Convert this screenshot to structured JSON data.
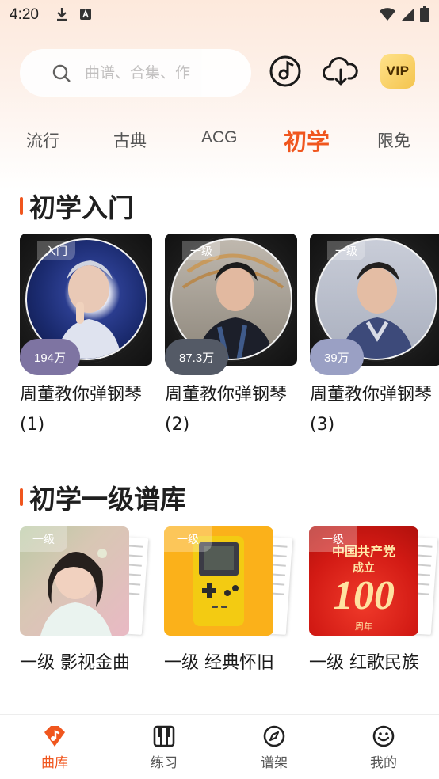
{
  "status_bar": {
    "time": "4:20"
  },
  "search": {
    "placeholder": "曲谱、合集、作"
  },
  "top_actions": {
    "vip_label": "VIP"
  },
  "tabs": [
    {
      "label": "流行",
      "active": false
    },
    {
      "label": "古典",
      "active": false
    },
    {
      "label": "ACG",
      "active": false
    },
    {
      "label": "初学",
      "active": true
    },
    {
      "label": "限免",
      "active": false
    }
  ],
  "section1": {
    "title": "初学入门",
    "cards": [
      {
        "tag": "入门",
        "count": "194万",
        "title": "周董教你弹钢琴 (1)"
      },
      {
        "tag": "一级",
        "count": "87.3万",
        "title": "周董教你弹钢琴 (2)"
      },
      {
        "tag": "一级",
        "count": "39万",
        "title": "周董教你弹钢琴 (3)"
      }
    ]
  },
  "section2": {
    "title": "初学一级谱库",
    "cards": [
      {
        "tag": "一级",
        "title": "一级 影视金曲"
      },
      {
        "tag": "一级",
        "title": "一级 经典怀旧"
      },
      {
        "tag": "一级",
        "title": "一级 红歌民族",
        "poster_text": "中国共产党",
        "poster_sub": "成立",
        "poster_num": "100",
        "poster_foot": "周年"
      }
    ]
  },
  "bottom_nav": [
    {
      "label": "曲库",
      "active": true
    },
    {
      "label": "练习",
      "active": false
    },
    {
      "label": "谱架",
      "active": false
    },
    {
      "label": "我的",
      "active": false
    }
  ],
  "colors": {
    "accent": "#f0561e",
    "vip": "#f4c44e"
  }
}
